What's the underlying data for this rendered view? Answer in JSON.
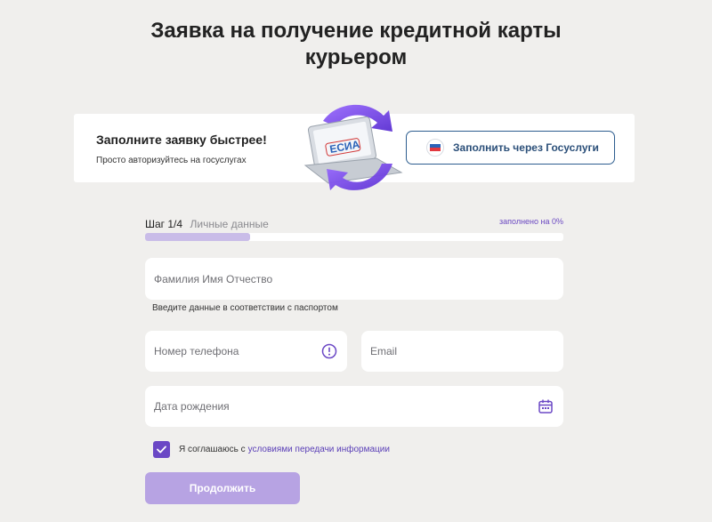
{
  "page": {
    "title_line1": "Заявка на получение кредитной карты",
    "title_line2": "курьером"
  },
  "gosuslugi_banner": {
    "title": "Заполните заявку быстрее!",
    "subtitle": "Просто авторизуйтесь на госуслугах",
    "illustration_text": "ЕСИА",
    "button_label": "Заполнить через Госуслуги",
    "button_icon": "gosuslugi-logo-icon"
  },
  "progress": {
    "step_label": "Шаг 1/4",
    "step_name": "Личные данные",
    "filled_text": "заполнено на 0%",
    "fill_fraction": 0.25
  },
  "form": {
    "fio_placeholder": "Фамилия Имя Отчество",
    "fio_hint": "Введите данные в соответствии с паспортом",
    "phone_placeholder": "Номер телефона",
    "phone_icon": "info-icon",
    "email_placeholder": "Email",
    "birthdate_placeholder": "Дата рождения",
    "birthdate_icon": "calendar-icon",
    "agree_checked": true,
    "agree_text": "Я соглашаюсь с",
    "agree_link": "условиями передачи информации",
    "submit_label": "Продолжить"
  },
  "colors": {
    "background": "#f0efed",
    "accent": "#6b48c5",
    "accent_light": "#b7a3e3",
    "progress_fill": "#c9bce8",
    "gos_blue": "#2b4f79"
  }
}
